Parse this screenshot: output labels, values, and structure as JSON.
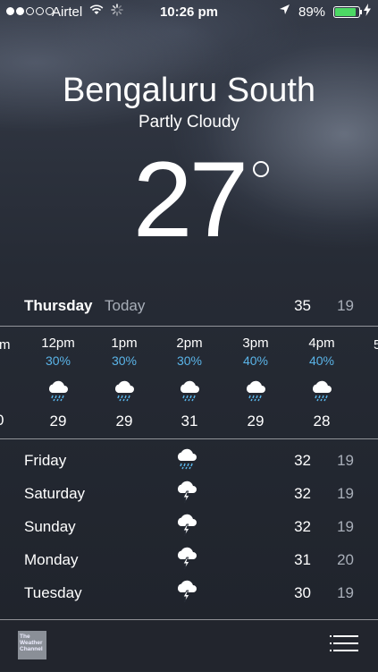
{
  "status_bar": {
    "carrier": "Airtel",
    "time": "10:26 pm",
    "battery_pct": "89%",
    "battery_level": 0.89
  },
  "location": {
    "city": "Bengaluru South",
    "condition": "Partly Cloudy",
    "temperature": "27"
  },
  "today": {
    "day": "Thursday",
    "label": "Today",
    "high": "35",
    "low": "19"
  },
  "hourly": [
    {
      "time": "12pm",
      "chance": "30%",
      "icon": "rain-cloud-icon",
      "temp": "29"
    },
    {
      "time": "1pm",
      "chance": "30%",
      "icon": "rain-cloud-icon",
      "temp": "29"
    },
    {
      "time": "2pm",
      "chance": "30%",
      "icon": "rain-cloud-icon",
      "temp": "31"
    },
    {
      "time": "3pm",
      "chance": "40%",
      "icon": "rain-cloud-icon",
      "temp": "29"
    },
    {
      "time": "4pm",
      "chance": "40%",
      "icon": "rain-cloud-icon",
      "temp": "28"
    }
  ],
  "hourly_edges": {
    "left_time": "m",
    "left_temp": "0",
    "right_time": "5"
  },
  "daily": [
    {
      "day": "Friday",
      "icon": "rain-cloud-icon",
      "high": "32",
      "low": "19"
    },
    {
      "day": "Saturday",
      "icon": "thunder-cloud-icon",
      "high": "32",
      "low": "19"
    },
    {
      "day": "Sunday",
      "icon": "thunder-cloud-icon",
      "high": "32",
      "low": "19"
    },
    {
      "day": "Monday",
      "icon": "thunder-cloud-icon",
      "high": "31",
      "low": "20"
    },
    {
      "day": "Tuesday",
      "icon": "thunder-cloud-icon",
      "high": "30",
      "low": "19"
    }
  ],
  "bottom_bar": {
    "logo_text": "The Weather Channel",
    "menu_icon": "list-icon"
  },
  "colors": {
    "accent_blue": "#5ab4e8",
    "battery_green": "#4cd964",
    "muted_text": "#a8aeb8"
  }
}
